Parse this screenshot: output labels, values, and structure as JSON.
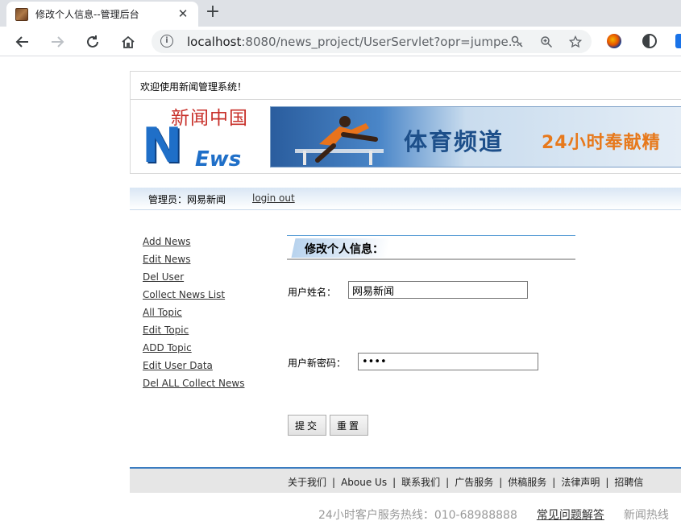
{
  "browser": {
    "tab_title": "修改个人信息--管理后台",
    "url_host": "localhost",
    "url_rest": ":8080/news_project/UserServlet?opr=jumpe..."
  },
  "page": {
    "welcome": "欢迎使用新闻管理系统！",
    "logo_text_cn": "新闻中国",
    "logo_text_n": "N",
    "logo_text_ews": "Ews",
    "banner_title": "体育频道",
    "banner_sub": "24小时奉献精",
    "admin_label": "管理员：网易新闻",
    "logout": "login out",
    "side_nav": [
      "Add News",
      "Edit News",
      "Del User",
      "Collect News List",
      "All Topic",
      "Edit Topic",
      "ADD Topic",
      "Edit User Data",
      "Del ALL Collect News"
    ],
    "form": {
      "title": "修改个人信息：",
      "username_label": "用户姓名：",
      "username_value": "网易新闻",
      "password_label": "用户新密码：",
      "password_value": "1234",
      "submit": "提交",
      "reset": "重置"
    },
    "footer_links": [
      "关于我们",
      "Aboue Us",
      "联系我们",
      "广告服务",
      "供稿服务",
      "法律声明",
      "招聘信"
    ],
    "hotline": "24小时客户服务热线：010-68988888",
    "faq": "常见问题解答",
    "news_hotline": "新闻热线"
  },
  "colors": {
    "accent_blue": "#3a7cc0",
    "logo_red": "#c8302a",
    "logo_blue": "#1f6fc8",
    "banner_orange": "#e7791c"
  }
}
